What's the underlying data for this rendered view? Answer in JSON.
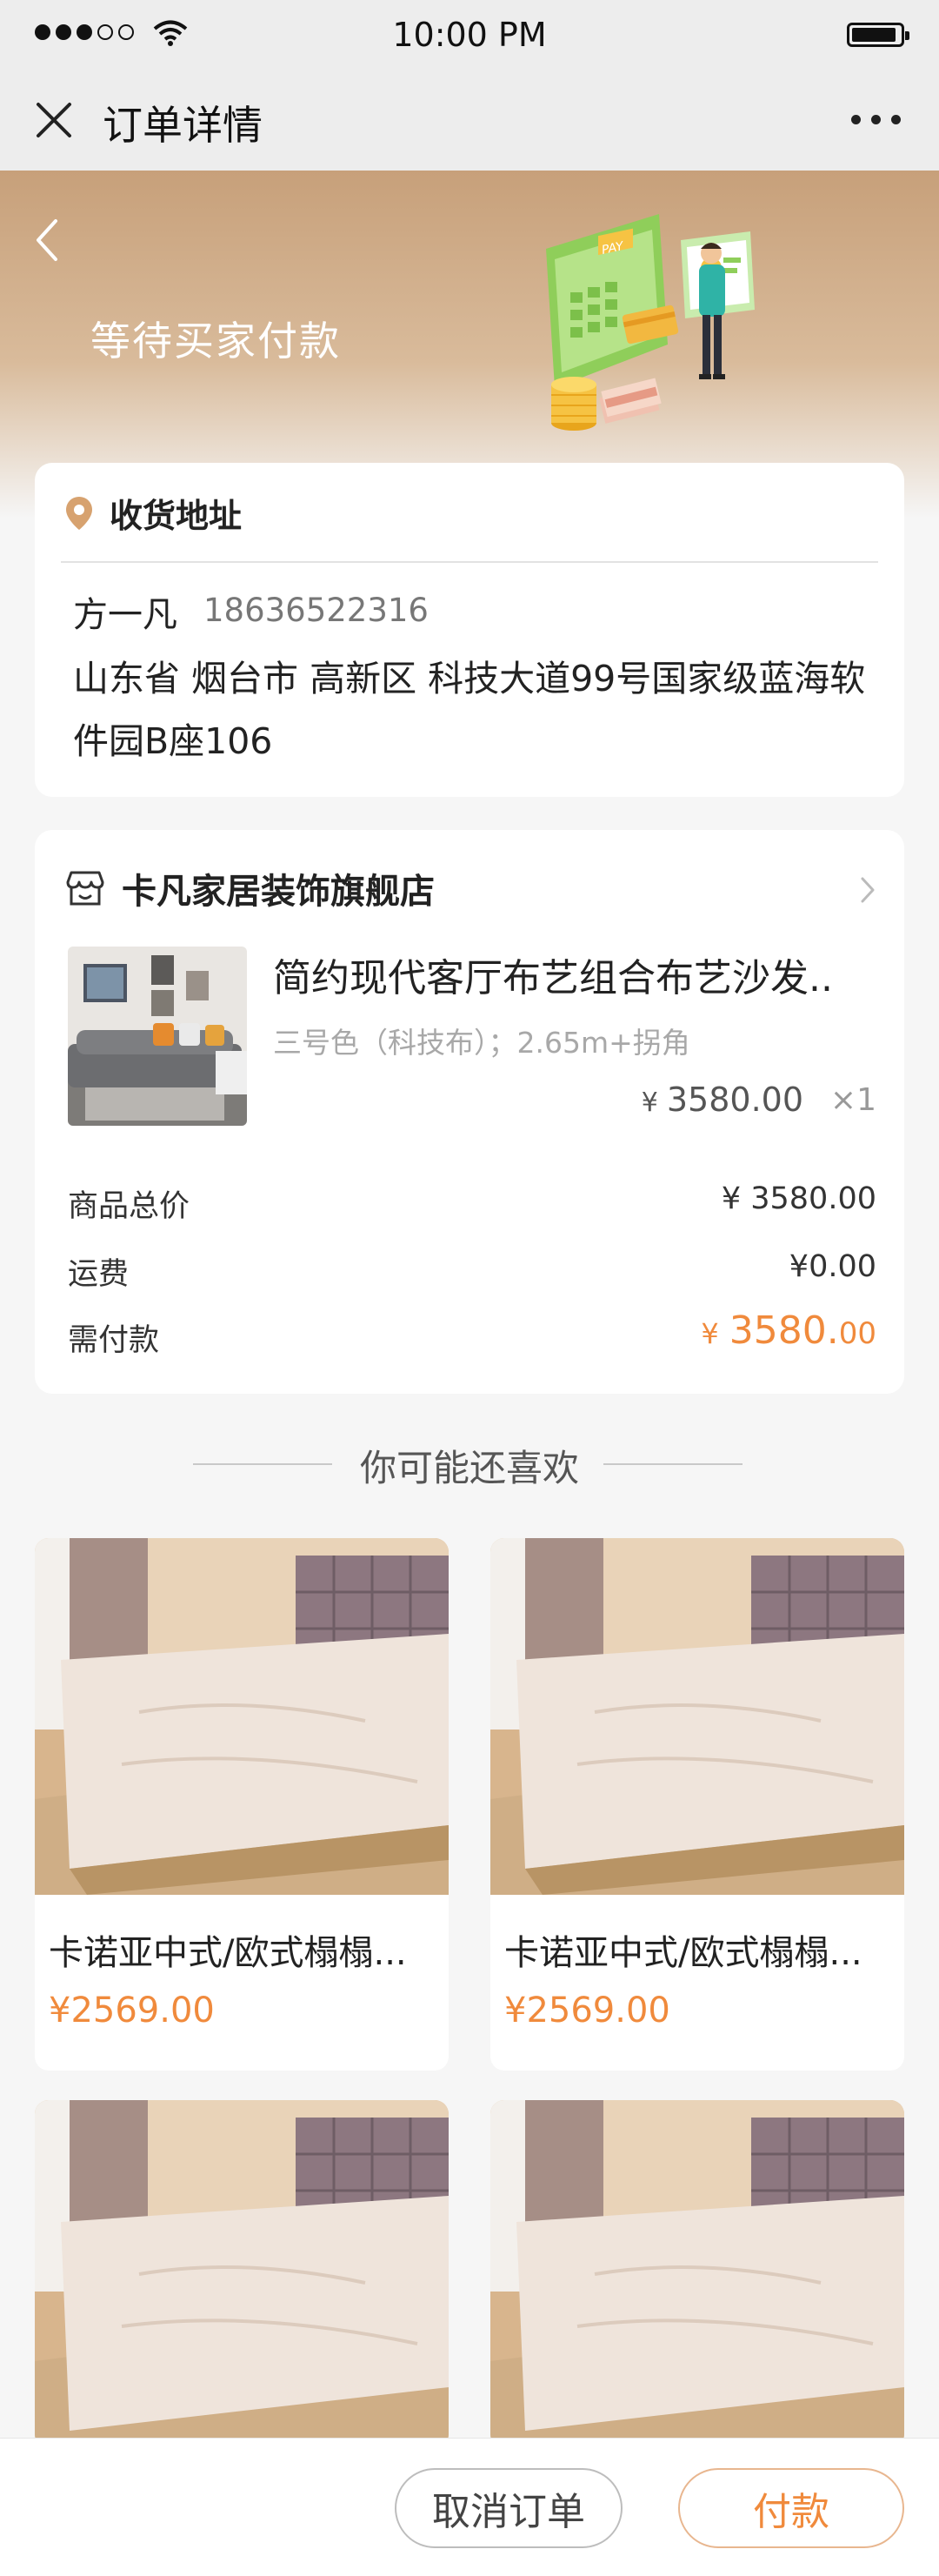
{
  "status_bar": {
    "time": "10:00 PM"
  },
  "nav": {
    "title": "订单详情"
  },
  "hero": {
    "status_text": "等待买家付款"
  },
  "address": {
    "section_title": "收货地址",
    "name": "方一凡",
    "phone": "18636522316",
    "line": "山东省 烟台市 高新区 科技大道99号国家级蓝海软件园B座106"
  },
  "order": {
    "shop_name": "卡凡家居装饰旗舰店",
    "product": {
      "name": "简约现代客厅布艺组合布艺沙发..",
      "spec": "三号色（科技布）；2.65m+拐角",
      "currency": "¥",
      "price": "3580.00",
      "qty": "×1"
    },
    "summary": {
      "subtotal_label": "商品总价",
      "subtotal_value": "¥ 3580.00",
      "shipping_label": "运费",
      "shipping_value": "¥0.00",
      "due_label": "需付款",
      "due_currency": "¥",
      "due_int": "3580.",
      "due_cents": "00"
    }
  },
  "recommend": {
    "title": "你可能还喜欢",
    "items": [
      {
        "name": "卡诺亚中式/欧式榻榻...",
        "price": "¥2569.00"
      },
      {
        "name": "卡诺亚中式/欧式榻榻...",
        "price": "¥2569.00"
      },
      {
        "name": "",
        "price": ""
      },
      {
        "name": "",
        "price": ""
      }
    ]
  },
  "actions": {
    "cancel_label": "取消订单",
    "pay_label": "付款"
  },
  "colors": {
    "accent": "#f08a3c",
    "hero_brown": "#c7a07a"
  }
}
